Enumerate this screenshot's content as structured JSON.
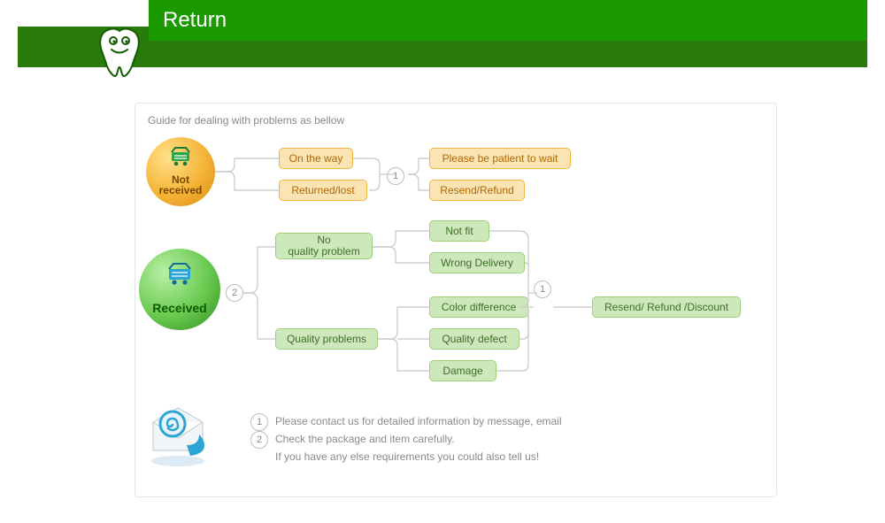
{
  "header": {
    "title": "Return"
  },
  "guide": "Guide for dealing with problems as bellow",
  "badges": {
    "not_received": "Not\nreceived",
    "received": "Received"
  },
  "nr": {
    "on_way": "On the way",
    "returned": "Returned/lost",
    "wait": "Please be patient to wait",
    "resend": "Resend/Refund"
  },
  "rc": {
    "noqp": "No\nquality problem",
    "qp": "Quality problems",
    "not_fit": "Not fit",
    "wrong": "Wrong Delivery",
    "color": "Color difference",
    "defect": "Quality defect",
    "damage": "Damage",
    "action": "Resend/ Refund /Discount"
  },
  "steps": {
    "s1": "1",
    "s2": "2"
  },
  "legend": {
    "l1": "Please contact us for detailed information by message, email",
    "l2": "Check the package and item carefully.",
    "extra": "If you have any else requirements you could also tell us!"
  }
}
